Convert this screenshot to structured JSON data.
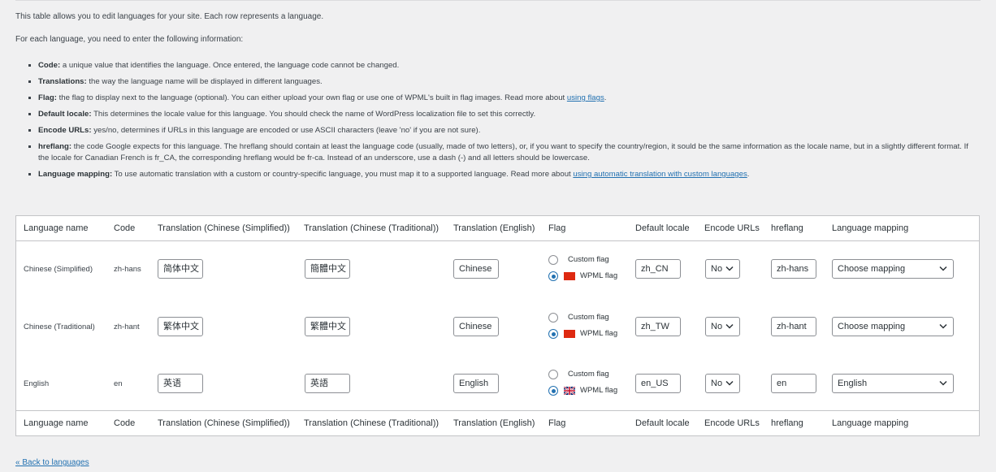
{
  "intro": {
    "p1": "This table allows you to edit languages for your site. Each row represents a language.",
    "p2": "For each language, you need to enter the following information:",
    "items": [
      {
        "term": "Code:",
        "text": " a unique value that identifies the language. Once entered, the language code cannot be changed."
      },
      {
        "term": "Translations:",
        "text": " the way the language name will be displayed in different languages."
      },
      {
        "term": "Flag:",
        "text": " the flag to display next to the language (optional). You can either upload your own flag or use one of WPML's built in flag images. Read more about ",
        "link": "using flags",
        "after": "."
      },
      {
        "term": "Default locale:",
        "text": " This determines the locale value for this language. You should check the name of WordPress localization file to set this correctly."
      },
      {
        "term": "Encode URLs:",
        "text": " yes/no, determines if URLs in this language are encoded or use ASCII characters (leave 'no' if you are not sure)."
      },
      {
        "term": "hreflang:",
        "text": " the code Google expects for this language. The hreflang should contain at least the language code (usually, made of two letters), or, if you want to specify the country/region, it sould be the same information as the locale name, but in a slightly different format. If the locale for Canadian French is fr_CA, the corresponding hreflang would be fr-ca. Instead of an underscore, use a dash (-) and all letters should be lowercase."
      },
      {
        "term": "Language mapping:",
        "text": " To use automatic translation with a custom or country-specific language, you must map it to a supported language. Read more about ",
        "link": "using automatic translation with custom languages",
        "after": "."
      }
    ]
  },
  "table": {
    "headers": [
      "Language name",
      "Code",
      "Translation (Chinese (Simplified))",
      "Translation (Chinese (Traditional))",
      "Translation (English)",
      "Flag",
      "Default locale",
      "Encode URLs",
      "hreflang",
      "Language mapping"
    ],
    "flag_options": {
      "custom": "Custom flag",
      "wpml": "WPML flag"
    },
    "rows": [
      {
        "name": "Chinese (Simplified)",
        "code": "zh-hans",
        "t_simplified": "简体中文",
        "t_traditional": "簡體中文",
        "t_english": "Chinese",
        "flag": "cn-flag",
        "locale": "zh_CN",
        "encode": "No",
        "hreflang": "zh-hans",
        "mapping": "Choose mapping"
      },
      {
        "name": "Chinese (Traditional)",
        "code": "zh-hant",
        "t_simplified": "繁体中文",
        "t_traditional": "繁體中文",
        "t_english": "Chinese",
        "flag": "tw-flag",
        "locale": "zh_TW",
        "encode": "No",
        "hreflang": "zh-hant",
        "mapping": "Choose mapping"
      },
      {
        "name": "English",
        "code": "en",
        "t_simplified": "英语",
        "t_traditional": "英語",
        "t_english": "English",
        "flag": "uk-flag",
        "locale": "en_US",
        "encode": "No",
        "hreflang": "en",
        "mapping": "English"
      }
    ]
  },
  "back_link": "« Back to languages",
  "colors": {
    "link": "#2271b1",
    "border": "#c3c4c7",
    "flag_red": "#de2910"
  }
}
